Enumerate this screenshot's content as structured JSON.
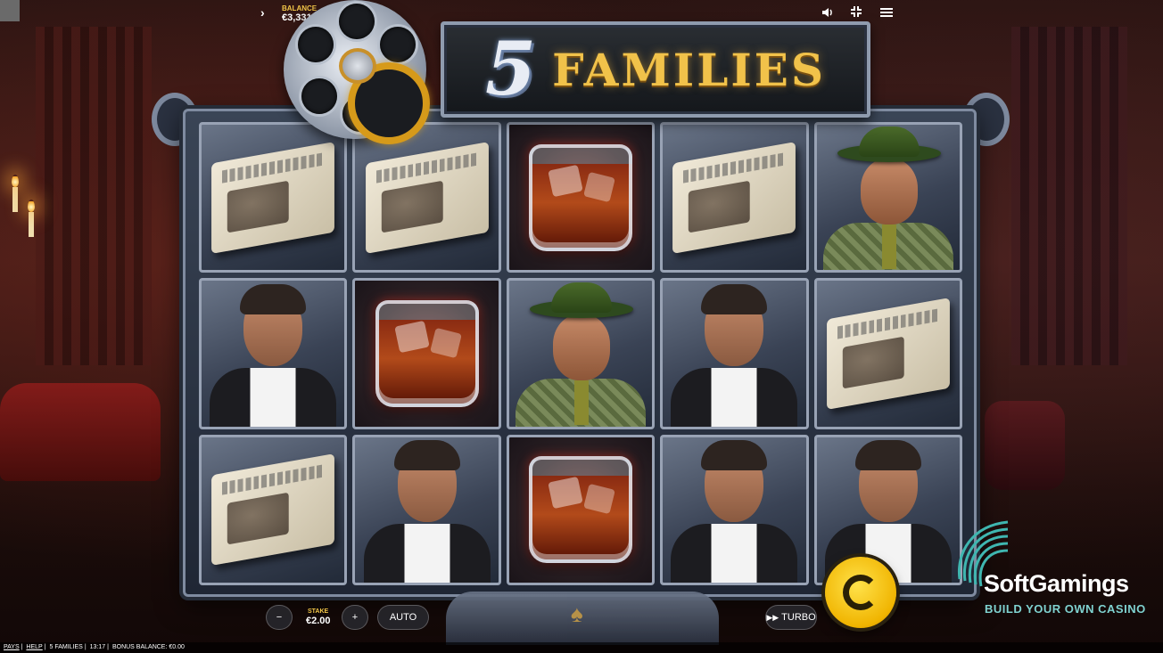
{
  "header": {
    "balance_label": "BALANCE",
    "balance_value": "€3,331.55"
  },
  "logo": {
    "number": "5",
    "word": "FAMILIES"
  },
  "reels": [
    [
      "newspaper",
      "newspaper",
      "whisky",
      "newspaper",
      "boss"
    ],
    [
      "gangster",
      "whisky",
      "boss",
      "gangster",
      "newspaper"
    ],
    [
      "newspaper",
      "gangster",
      "whisky",
      "gangster",
      "gangster"
    ]
  ],
  "controls": {
    "minus_label": "−",
    "stake_label": "STAKE",
    "stake_value": "€2.00",
    "plus_label": "+",
    "auto_label": "AUTO",
    "turbo_label": "TURBO"
  },
  "statusbar": {
    "pays": "PAYS",
    "help": "HELP",
    "game": "5 FAMILIES",
    "time": "13:17",
    "bonus": "BONUS BALANCE: €0.00"
  },
  "watermark": {
    "name": "SoftGamings",
    "tagline": "BUILD YOUR OWN CASINO"
  },
  "icons": {
    "menu_toggle": "chevron-right-icon",
    "sound": "speaker-icon",
    "fullscreen": "collapse-icon",
    "menu": "hamburger-icon",
    "spin": "spin-arrows-icon",
    "turbo": "fast-forward-icon"
  },
  "colors": {
    "accent_gold": "#f2c648",
    "spin_button": "#f0b400",
    "frame_silver": "#8f9bae"
  }
}
